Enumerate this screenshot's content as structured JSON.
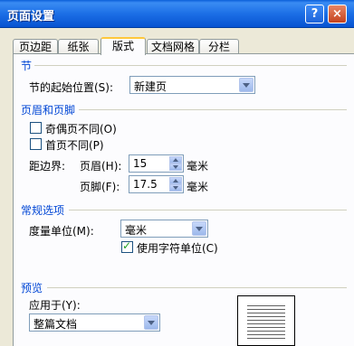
{
  "window": {
    "title": "页面设置",
    "help_label": "?",
    "close_label": "×"
  },
  "tabs": [
    {
      "label": "页边距",
      "active": false
    },
    {
      "label": "纸张",
      "active": false
    },
    {
      "label": "版式",
      "active": true
    },
    {
      "label": "文档网格",
      "active": false
    },
    {
      "label": "分栏",
      "active": false
    }
  ],
  "section": {
    "title": "节",
    "start_label": "节的起始位置(S):",
    "start_value": "新建页"
  },
  "header_footer": {
    "title": "页眉和页脚",
    "odd_even_label": "奇偶页不同(O)",
    "odd_even_checked": false,
    "first_page_label": "首页不同(P)",
    "first_page_checked": false,
    "from_edge_label": "距边界:",
    "header_label": "页眉(H):",
    "header_value": "15",
    "header_unit": "毫米",
    "footer_label": "页脚(F):",
    "footer_value": "17.5",
    "footer_unit": "毫米"
  },
  "options": {
    "title": "常规选项",
    "unit_label": "度量单位(M):",
    "unit_value": "毫米",
    "char_unit_label": "使用字符单位(C)",
    "char_unit_checked": true
  },
  "preview": {
    "title": "预览",
    "apply_label": "应用于(Y):",
    "apply_value": "整篇文档"
  }
}
